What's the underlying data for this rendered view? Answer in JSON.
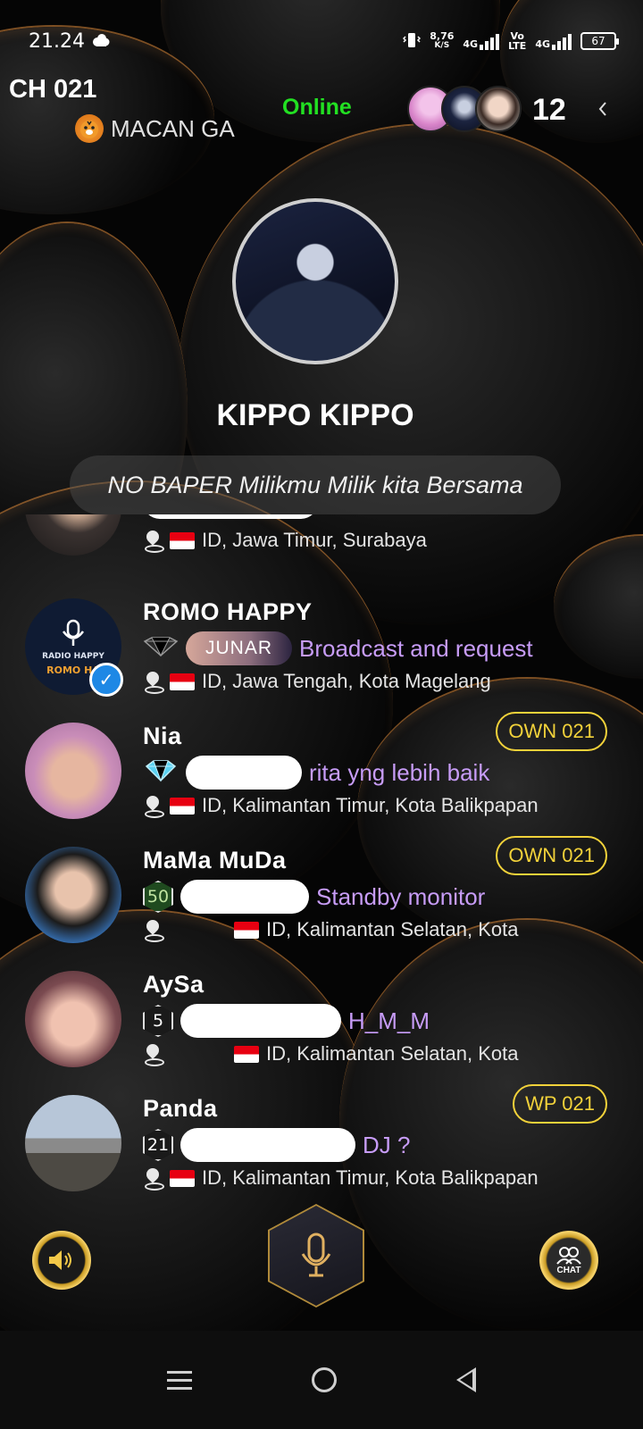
{
  "status_bar": {
    "time": "21.24",
    "net_speed_value": "8,76",
    "net_speed_unit": "K/S",
    "net_1": "4G",
    "volte_top": "Vo",
    "volte_bottom": "LTE",
    "net_2": "4G",
    "battery": "67"
  },
  "header": {
    "room_id": "CH 021",
    "room_name": "MACAN GA",
    "status": "Online",
    "viewer_count": "12"
  },
  "host": {
    "name": "KIPPO KIPPO",
    "motto": "NO BAPER Milikmu Milik kita Bersama"
  },
  "seats": [
    {
      "name": "",
      "message": "",
      "location": "ID, Jawa Timur, Surabaya"
    },
    {
      "name": "ROMO HAPPY",
      "badge": "JUNAR",
      "message": "Broadcast and request",
      "location": "ID, Jawa Tengah, Kota Magelang",
      "avatar_text_1": "RADIO HAPPY",
      "avatar_text_2": "ROMO HA"
    },
    {
      "name": "Nia",
      "role": "OWN 021",
      "message": "rita yng lebih baik",
      "location": "ID, Kalimantan Timur, Kota Balikpapan"
    },
    {
      "name": "MaMa MuDa",
      "role": "OWN 021",
      "level": "50",
      "message": "Standby monitor",
      "location": "ID, Kalimantan Selatan, Kota"
    },
    {
      "name": "AySa",
      "level": "5",
      "message": "H_M_M",
      "location": "ID, Kalimantan Selatan, Kota"
    },
    {
      "name": "Panda",
      "role": "WP 021",
      "level": "21",
      "message": "DJ ?",
      "location": "ID, Kalimantan Timur, Kota Balikpapan"
    }
  ],
  "controls": {
    "chat_label": "CHAT"
  },
  "colors": {
    "online": "#22e022",
    "message": "#c79cf7",
    "role_badge": "#f2d23a",
    "rim": "#e08c3c"
  },
  "icons": [
    "cloud-icon",
    "vibrate-icon",
    "signal-icon",
    "battery-icon",
    "tiger-icon",
    "chevron-left-icon",
    "location-pin-icon",
    "indonesia-flag-icon",
    "diamond-icon",
    "verified-icon",
    "speaker-icon",
    "microphone-icon",
    "chat-icon",
    "menu-icon",
    "home-icon",
    "back-icon"
  ]
}
